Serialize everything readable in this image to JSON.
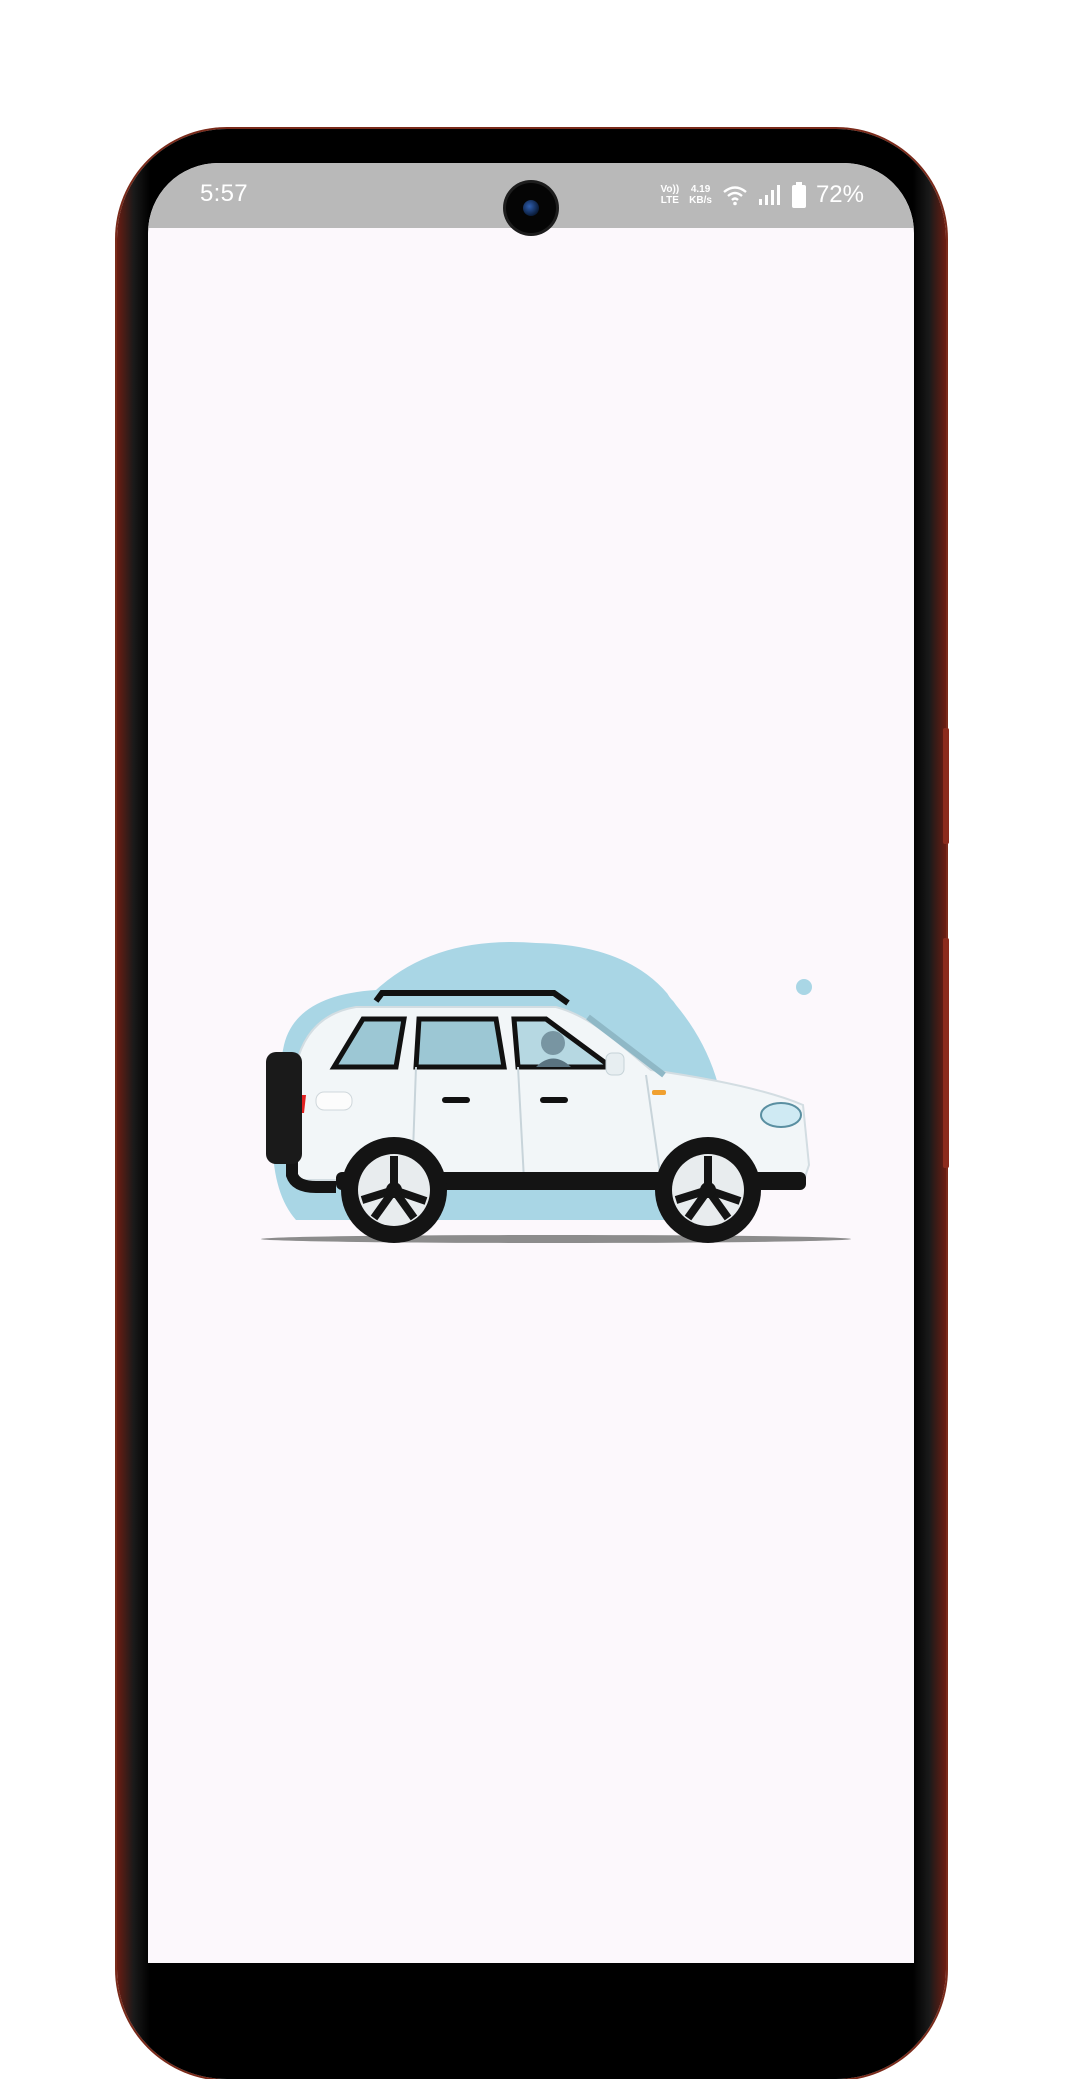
{
  "status_bar": {
    "time": "5:57",
    "network_label_top": "Vo))",
    "network_label_bottom": "LTE",
    "speed_value": "4.19",
    "speed_unit": "KB/s",
    "battery_percent": "72%",
    "icons": [
      "volte-icon",
      "wifi-icon",
      "signal-icon",
      "battery-icon"
    ]
  },
  "illustration": {
    "subject": "car-illustration",
    "colors": {
      "background_blob": "#a9d6e5",
      "car_body": "#f2f6f8",
      "tyre": "#141414",
      "brake_light": "#e02020",
      "indicator": "#f0a030"
    }
  },
  "colors": {
    "screen_background": "#fcf8fc",
    "status_bar": "#b9b9b9",
    "frame_accent": "#7a2a1a"
  }
}
